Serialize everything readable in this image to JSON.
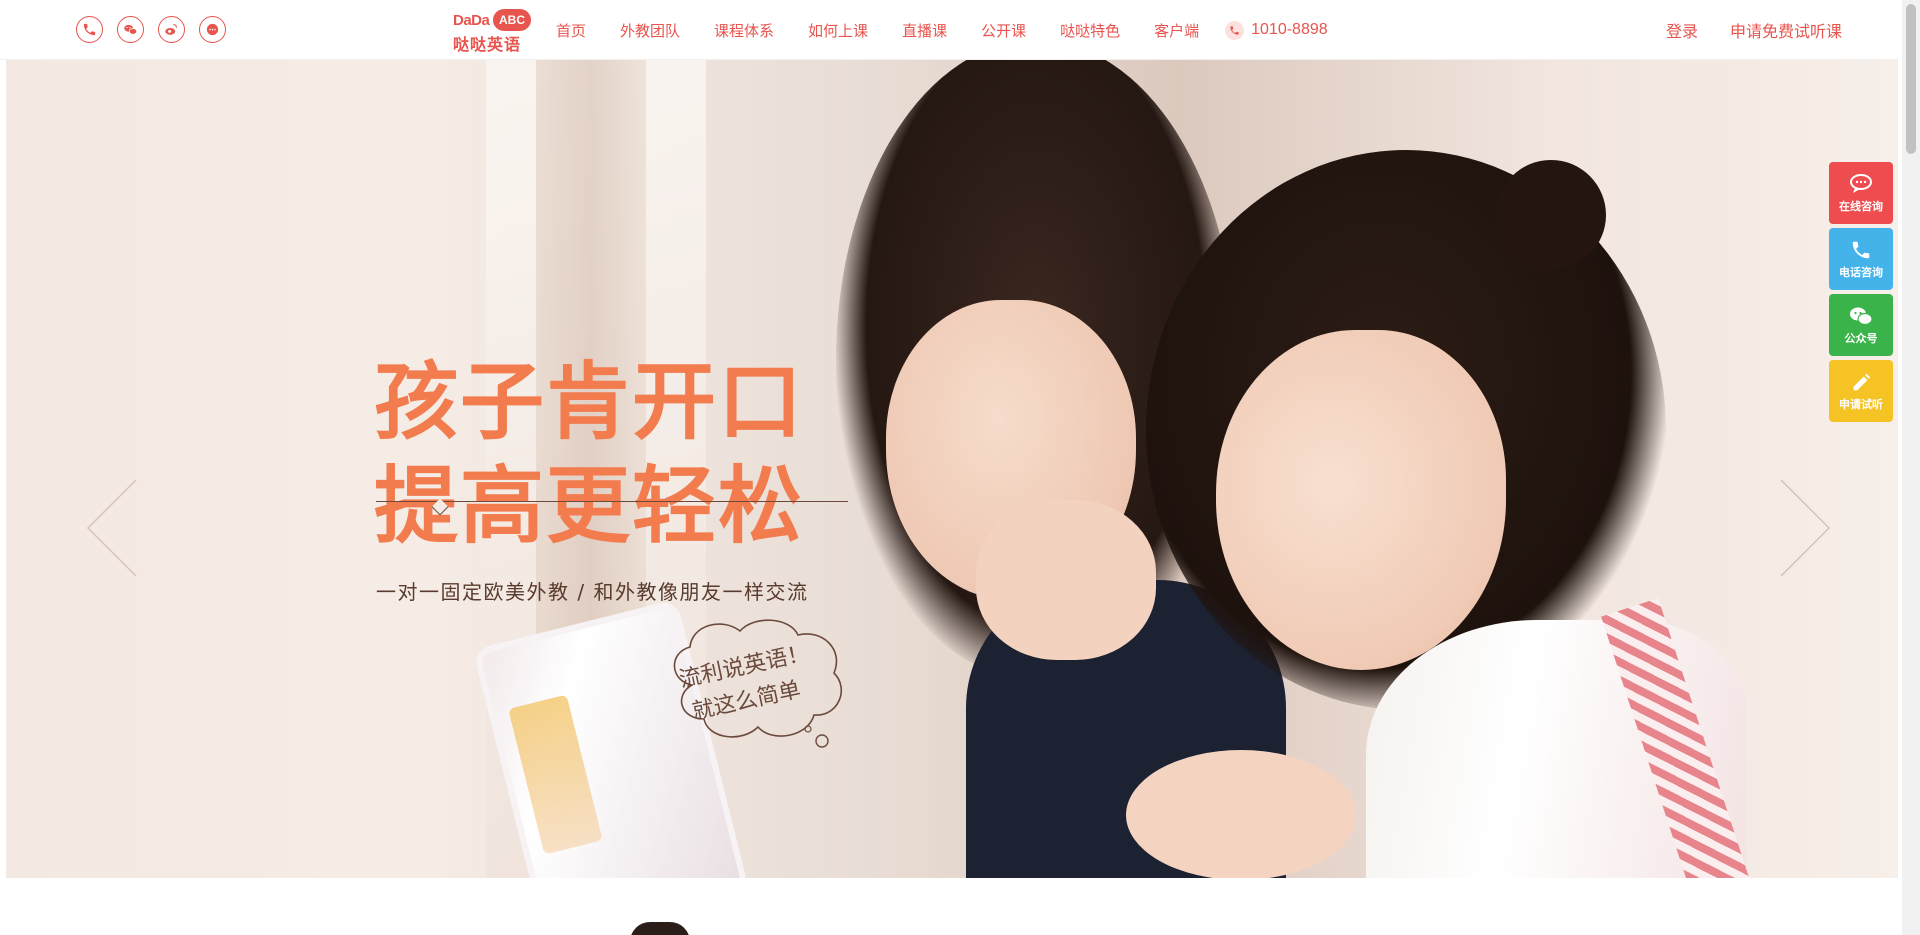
{
  "header": {
    "social_icons": [
      "phone-icon",
      "wechat-icon",
      "weibo-icon",
      "chat-icon"
    ],
    "logo": {
      "line1": "DaDa",
      "bubble": "ABC",
      "line2": "哒哒英语"
    },
    "nav": [
      "首页",
      "外教团队",
      "课程体系",
      "如何上课",
      "直播课",
      "公开课",
      "哒哒特色",
      "客户端"
    ],
    "phone": "1010-8898",
    "login": "登录",
    "trial": "申请免费试听课"
  },
  "banner": {
    "headline_1": "孩子肯开口",
    "headline_2": "提高更轻松",
    "subline": "一对一固定欧美外教 / 和外教像朋友一样交流",
    "cloud_line_1": "流利说英语！",
    "cloud_line_2": "就这么简单",
    "slide_count": 6,
    "active_slide": 1
  },
  "side_panel": [
    {
      "label": "在线咨询",
      "icon": "chat-bubble-icon",
      "color": "#ee4c4f"
    },
    {
      "label": "电话咨询",
      "icon": "phone-icon",
      "color": "#44b3ea"
    },
    {
      "label": "公众号",
      "icon": "wechat-icon",
      "color": "#3ab44a"
    },
    {
      "label": "申请试听",
      "icon": "pencil-icon",
      "color": "#f6c325"
    }
  ],
  "colors": {
    "brand": "#e8544e",
    "headline": "#f27c4e"
  }
}
